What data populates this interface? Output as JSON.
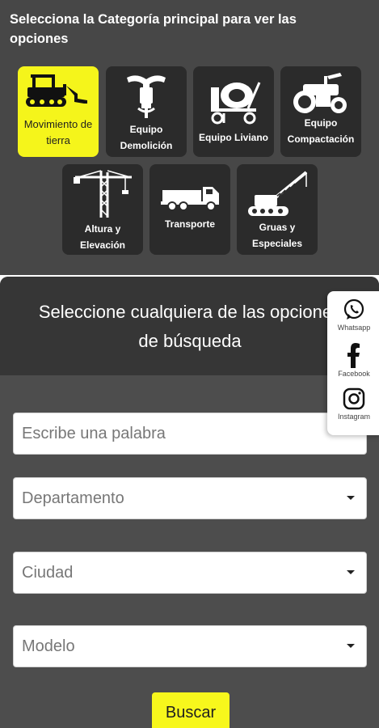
{
  "categories": {
    "title": "Selecciona la Categoría principal para ver las opciones",
    "items": [
      {
        "label": "Movimiento de tierra",
        "icon": "bulldozer-icon",
        "active": true
      },
      {
        "label": "Equipo Demolición",
        "icon": "jackhammer-icon",
        "active": false
      },
      {
        "label": "Equipo Liviano",
        "icon": "concrete-mixer-icon",
        "active": false
      },
      {
        "label": "Equipo Compactación",
        "icon": "road-roller-icon",
        "active": false
      },
      {
        "label": "Altura y Elevación",
        "icon": "tower-crane-icon",
        "active": false
      },
      {
        "label": "Transporte",
        "icon": "dump-truck-icon",
        "active": false
      },
      {
        "label": "Gruas y Especiales",
        "icon": "crawler-crane-icon",
        "active": false
      }
    ]
  },
  "search": {
    "heading": "Seleccione cualquiera de las opciones de búsqueda",
    "keyword_placeholder": "Escribe una palabra",
    "departamento": "Departamento",
    "ciudad": "Ciudad",
    "modelo": "Modelo",
    "submit_label": "Buscar"
  },
  "social": {
    "whatsapp": "Whatsapp",
    "facebook": "Facebook",
    "instagram": "Instagram"
  },
  "colors": {
    "accent": "#f5f51b",
    "panel": "#474747",
    "tile": "#2b2b2b"
  }
}
